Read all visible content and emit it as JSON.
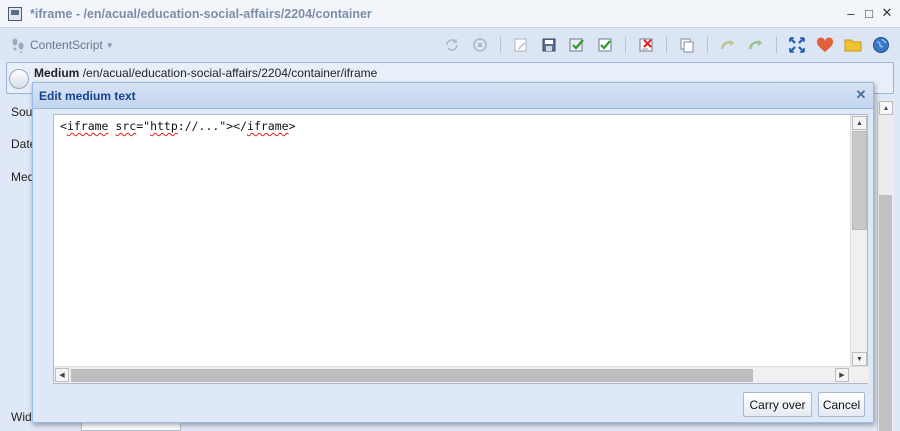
{
  "window": {
    "title": "*iframe - /en/acual/education-social-affairs/2204/container",
    "controls": [
      "minimize",
      "maximize",
      "close"
    ]
  },
  "toolbar": {
    "content_script_label": "ContentScript",
    "icons": [
      "refresh-icon",
      "stop-icon",
      "edit-icon",
      "save-icon",
      "save-and-check-icon",
      "check-icon",
      "delete-icon",
      "copy-icon",
      "undo-arrow-icon",
      "redo-arrow-icon",
      "expand-icon",
      "favorite-heart-icon",
      "folder-icon",
      "globe-icon"
    ]
  },
  "record": {
    "type_label": "Medium",
    "path": "/en/acual/education-social-affairs/2204/container/iframe"
  },
  "background_form": {
    "labels": [
      "Sou",
      "Date",
      "Med",
      "Widt"
    ]
  },
  "dialog": {
    "title": "Edit medium text",
    "code_tokens": [
      "<",
      "iframe",
      " ",
      "src",
      "=\"",
      "http",
      "://...\"></",
      "iframe",
      ">"
    ],
    "carry_over_label": "Carry over",
    "cancel_label": "Cancel"
  },
  "colors": {
    "accent_blue": "#15428b",
    "border_blue": "#99bbe8",
    "background": "#dfe8f6",
    "spell_error": "#e02020"
  }
}
